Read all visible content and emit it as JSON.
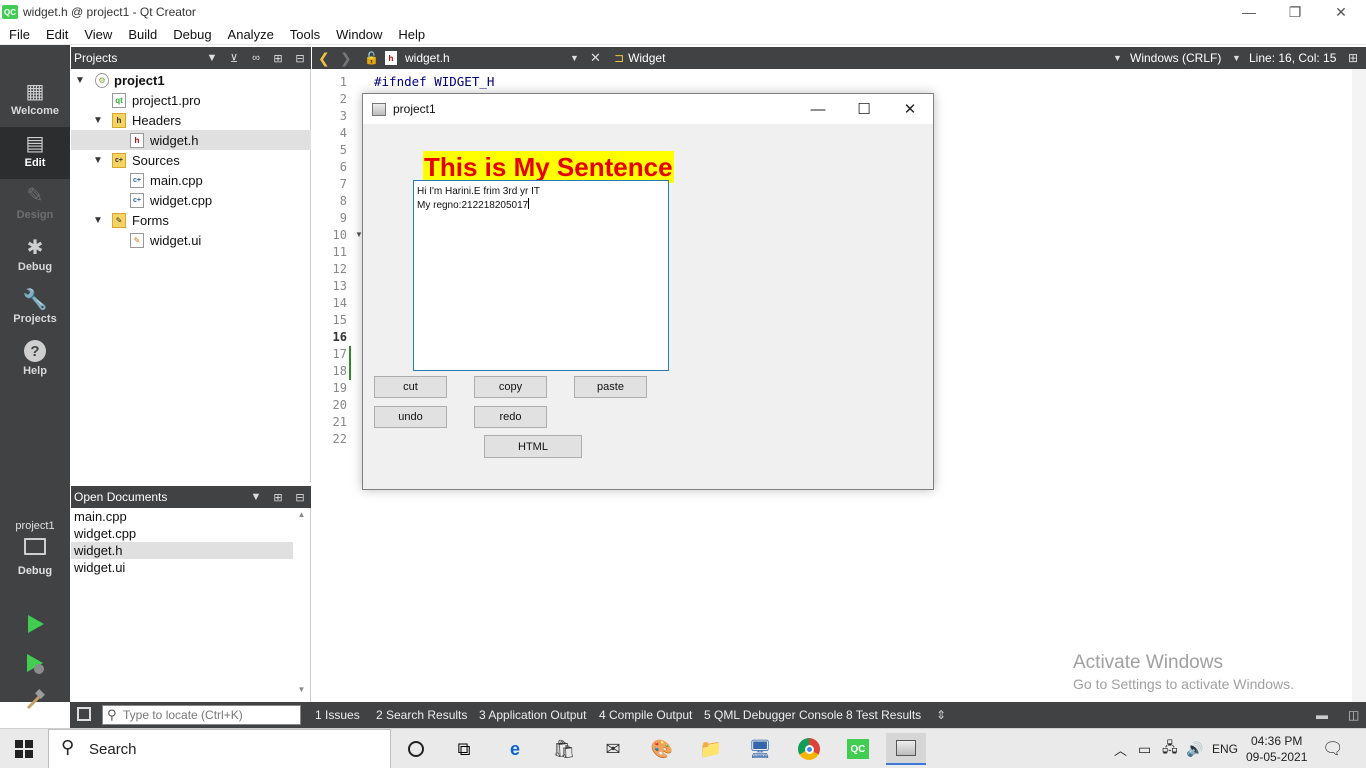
{
  "window": {
    "title": "widget.h @ project1 - Qt Creator",
    "logo_text": "QC",
    "minimize_glyph": "—",
    "restore_glyph": "❐",
    "close_glyph": "✕"
  },
  "menu": [
    "File",
    "Edit",
    "View",
    "Build",
    "Debug",
    "Analyze",
    "Tools",
    "Window",
    "Help"
  ],
  "modes": [
    {
      "label": "Welcome",
      "icon": "welcome-grid-icon",
      "glyph": "▦"
    },
    {
      "label": "Edit",
      "icon": "edit-document-icon",
      "glyph": "▤"
    },
    {
      "label": "Design",
      "icon": "design-pen-icon",
      "glyph": "✎"
    },
    {
      "label": "Debug",
      "icon": "debug-bug-icon",
      "glyph": "✱"
    },
    {
      "label": "Projects",
      "icon": "projects-wrench-icon",
      "glyph": "🔧"
    },
    {
      "label": "Help",
      "icon": "help-question-icon",
      "glyph": "?"
    }
  ],
  "kit": {
    "project": "project1",
    "mode": "Debug"
  },
  "projects_pane": {
    "title": "Projects",
    "tree": [
      {
        "label": "project1",
        "level": 0,
        "expanded": true,
        "bold": true,
        "icon": "project-icon"
      },
      {
        "label": "project1.pro",
        "level": 1,
        "icon": "pro-file-icon"
      },
      {
        "label": "Headers",
        "level": 1,
        "expanded": true,
        "icon": "folder-h-icon"
      },
      {
        "label": "widget.h",
        "level": 2,
        "selected": true,
        "icon": "header-file-icon"
      },
      {
        "label": "Sources",
        "level": 1,
        "expanded": true,
        "icon": "folder-cpp-icon"
      },
      {
        "label": "main.cpp",
        "level": 2,
        "icon": "cpp-file-icon"
      },
      {
        "label": "widget.cpp",
        "level": 2,
        "icon": "cpp-file-icon"
      },
      {
        "label": "Forms",
        "level": 1,
        "expanded": true,
        "icon": "folder-ui-icon"
      },
      {
        "label": "widget.ui",
        "level": 2,
        "icon": "ui-file-icon"
      }
    ]
  },
  "open_documents": {
    "title": "Open Documents",
    "items": [
      {
        "label": "main.cpp"
      },
      {
        "label": "widget.cpp"
      },
      {
        "label": "widget.h",
        "selected": true
      },
      {
        "label": "widget.ui"
      }
    ]
  },
  "editor_toolbar": {
    "file": "widget.h",
    "symbol": "Widget",
    "line_endings": "Windows (CRLF)",
    "position": "Line: 16, Col: 15"
  },
  "editor": {
    "line_numbers": [
      "1",
      "2",
      "3",
      "4",
      "5",
      "6",
      "7",
      "8",
      "9",
      "10",
      "11",
      "12",
      "13",
      "14",
      "15",
      "16",
      "17",
      "18",
      "19",
      "20",
      "21",
      "22"
    ],
    "current_line": 16,
    "visible_code": "#ifndef WIDGET_H"
  },
  "watermark": {
    "line1": "Activate Windows",
    "line2": "Go to Settings to activate Windows."
  },
  "output_bar": {
    "locator_placeholder": "Type to locate (Ctrl+K)",
    "tabs": [
      "1  Issues",
      "2  Search Results",
      "3  Application Output",
      "4  Compile Output",
      "5  QML Debugger Console",
      "8  Test Results"
    ]
  },
  "app_window": {
    "title": "project1",
    "label": "This is My Sentence",
    "text_lines": [
      "Hi I'm Harini.E frim 3rd yr IT",
      "My regno:212218205017"
    ],
    "buttons": {
      "cut": "cut",
      "copy": "copy",
      "paste": "paste",
      "undo": "undo",
      "redo": "redo",
      "html": "HTML"
    }
  },
  "taskbar": {
    "search_label": "Search",
    "language": "ENG",
    "time": "04:36 PM",
    "date": "09-05-2021"
  },
  "colors": {
    "sidebar": "#404244",
    "label_bg": "#ffff00",
    "label_fg": "#e60000",
    "run_green": "#41cd52"
  }
}
